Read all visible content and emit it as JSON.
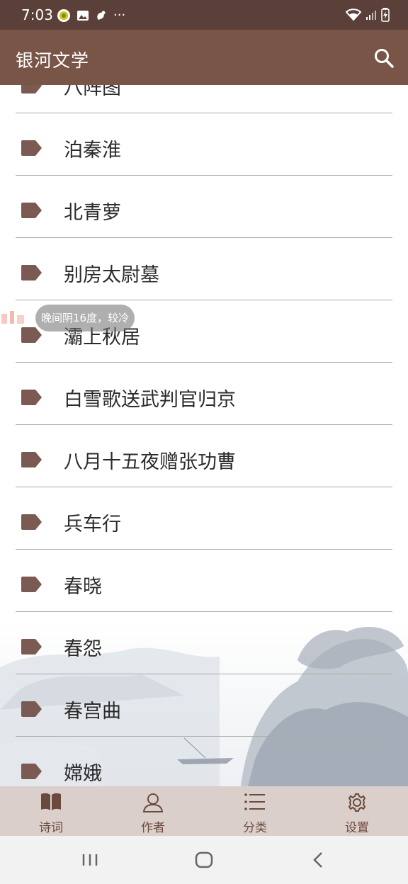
{
  "status_bar": {
    "time": "7:03",
    "dots": "···"
  },
  "app_bar": {
    "title": "银河文学"
  },
  "poems": [
    "八阵图",
    "泊秦淮",
    "北青萝",
    "别房太尉墓",
    "灞上秋居",
    "白雪歌送武判官归京",
    "八月十五夜赠张功曹",
    "兵车行",
    "春晓",
    "春怨",
    "春宫曲",
    "嫦娥"
  ],
  "weather_toast": "晚间阴16度，较冷",
  "bottom_nav": {
    "poems": "诗词",
    "authors": "作者",
    "categories": "分类",
    "settings": "设置"
  },
  "icons": {
    "tag": "tag-icon",
    "search": "search-icon"
  },
  "colors": {
    "status_bar": "#5a4038",
    "app_bar": "#795548",
    "bottom_nav": "#dbcfcb",
    "accent": "#6b4a3e"
  }
}
